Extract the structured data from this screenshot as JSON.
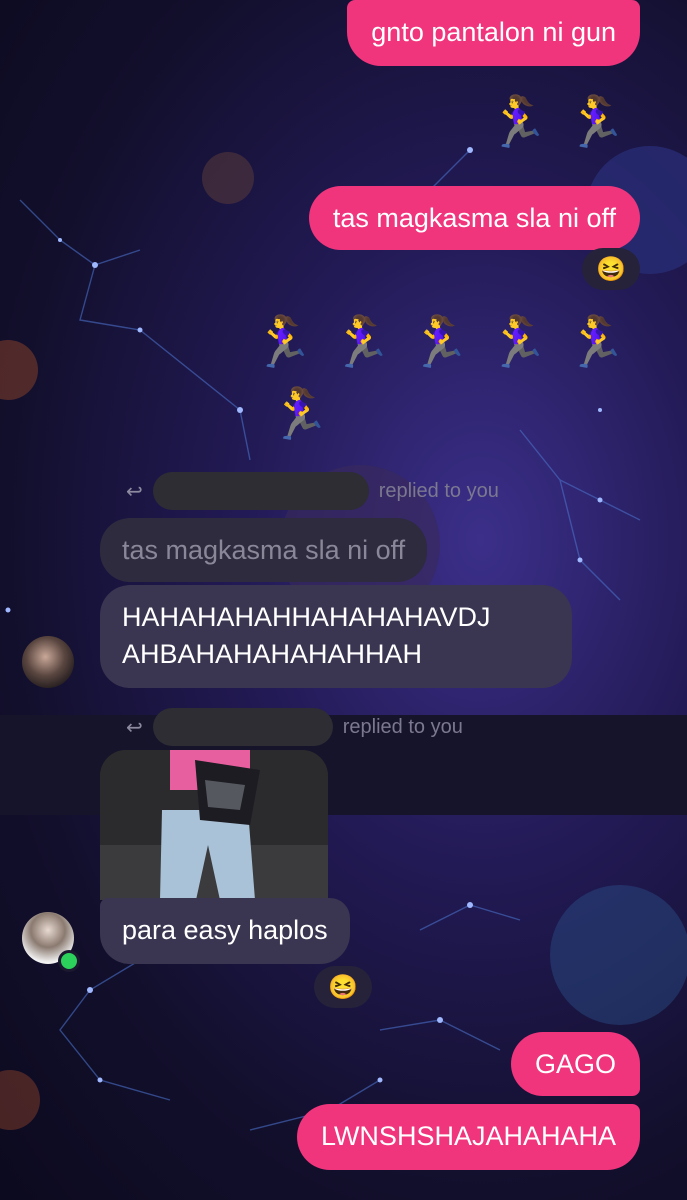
{
  "messages": {
    "out_1": "gnto pantalon ni gun",
    "out_2": "tas magkasma sla ni off",
    "out_3": "GAGO",
    "out_4": "LWNSHSHAJAHAHAHA",
    "reply_1_quoted": "tas magkasma sla ni off",
    "reply_1_text_line1": "HAHAHAHAHHAHAHAHAVDJ",
    "reply_1_text_line2": "AHBAHAHAHAHAHHAH",
    "reply_2_text": "para easy haplos"
  },
  "emoji": {
    "running_row_1": "🏃‍♀️🏃‍♀️",
    "running_row_2": "🏃‍♀️🏃‍♀️🏃‍♀️🏃‍♀️🏃‍♀️",
    "running_row_3": "🏃‍♀️",
    "reaction_1": "😆",
    "reaction_2": "😆"
  },
  "reply_meta": {
    "label_1": "replied to you",
    "label_2": "replied to you"
  },
  "icons": {
    "reply": "reply-arrow-icon",
    "reply_small": "reply-arrow-icon"
  },
  "colors": {
    "outgoing_bubble": "#f0357d",
    "incoming_bubble": "#3a3550",
    "quoted_bubble": "#2e2b3f",
    "online_dot": "#2bd15a"
  }
}
